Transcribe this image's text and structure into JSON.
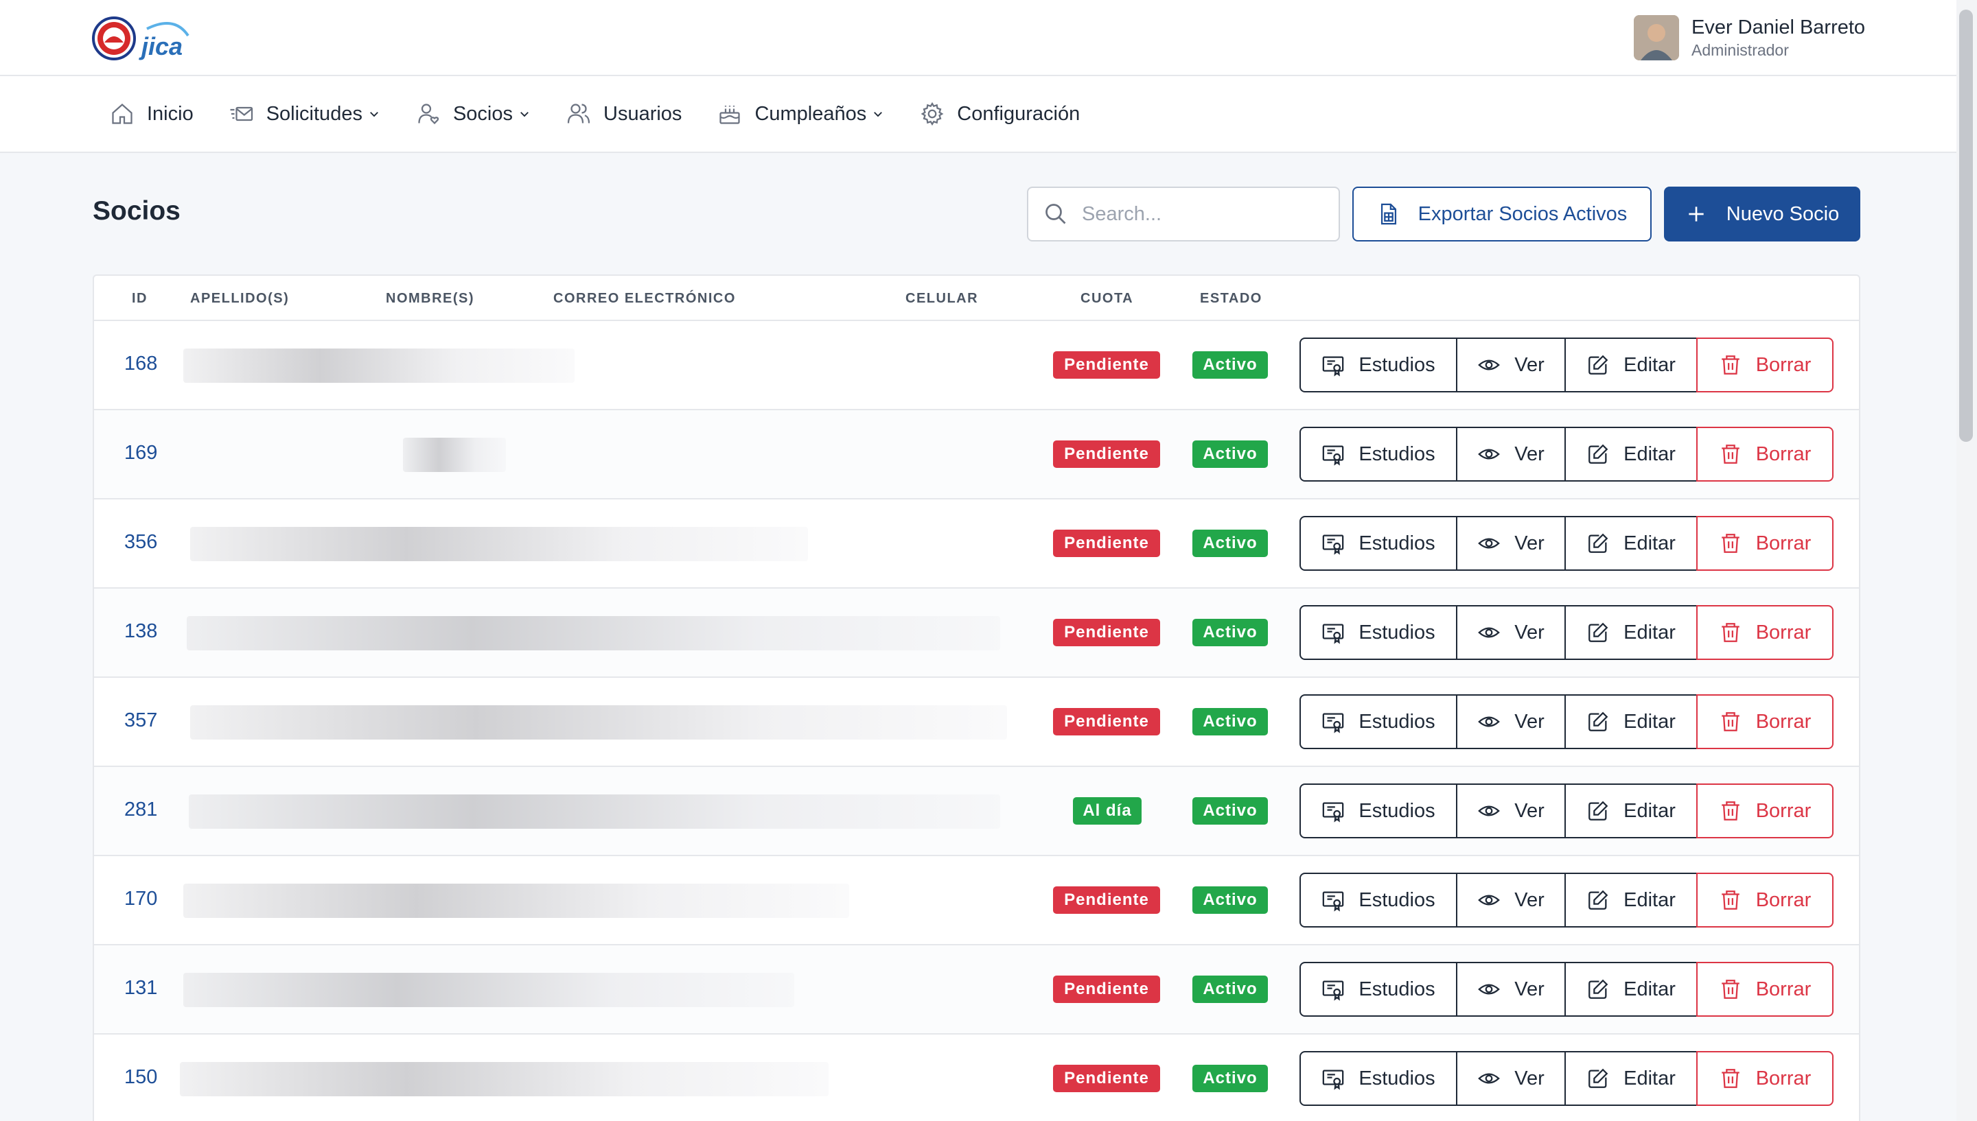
{
  "header": {
    "user_name": "Ever Daniel Barreto",
    "user_role": "Administrador"
  },
  "nav": {
    "items": [
      {
        "label": "Inicio",
        "icon": "home-icon"
      },
      {
        "label": "Solicitudes",
        "icon": "mail-icon",
        "dropdown": true
      },
      {
        "label": "Socios",
        "icon": "member-icon",
        "dropdown": true
      },
      {
        "label": "Usuarios",
        "icon": "users-icon"
      },
      {
        "label": "Cumpleaños",
        "icon": "cake-icon",
        "dropdown": true
      },
      {
        "label": "Configuración",
        "icon": "gear-icon"
      }
    ]
  },
  "page": {
    "title": "Socios",
    "search_placeholder": "Search...",
    "export_label": "Exportar Socios Activos",
    "new_label": "Nuevo Socio"
  },
  "table": {
    "columns": [
      "ID",
      "APELLIDO(S)",
      "NOMBRE(S)",
      "CORREO ELECTRÓNICO",
      "CELULAR",
      "CUOTA",
      "ESTADO"
    ],
    "actions": [
      "Estudios",
      "Ver",
      "Editar",
      "Borrar"
    ],
    "rows": [
      {
        "id": "168",
        "cuota": "Pendiente",
        "estado": "Activo"
      },
      {
        "id": "169",
        "cuota": "Pendiente",
        "estado": "Activo"
      },
      {
        "id": "356",
        "cuota": "Pendiente",
        "estado": "Activo"
      },
      {
        "id": "138",
        "cuota": "Pendiente",
        "estado": "Activo"
      },
      {
        "id": "357",
        "cuota": "Pendiente",
        "estado": "Activo"
      },
      {
        "id": "281",
        "cuota": "Al día",
        "estado": "Activo"
      },
      {
        "id": "170",
        "cuota": "Pendiente",
        "estado": "Activo"
      },
      {
        "id": "131",
        "cuota": "Pendiente",
        "estado": "Activo"
      },
      {
        "id": "150",
        "cuota": "Pendiente",
        "estado": "Activo"
      }
    ]
  },
  "colors": {
    "primary": "#1d4e97",
    "danger": "#dc3545",
    "success": "#22a74a"
  }
}
